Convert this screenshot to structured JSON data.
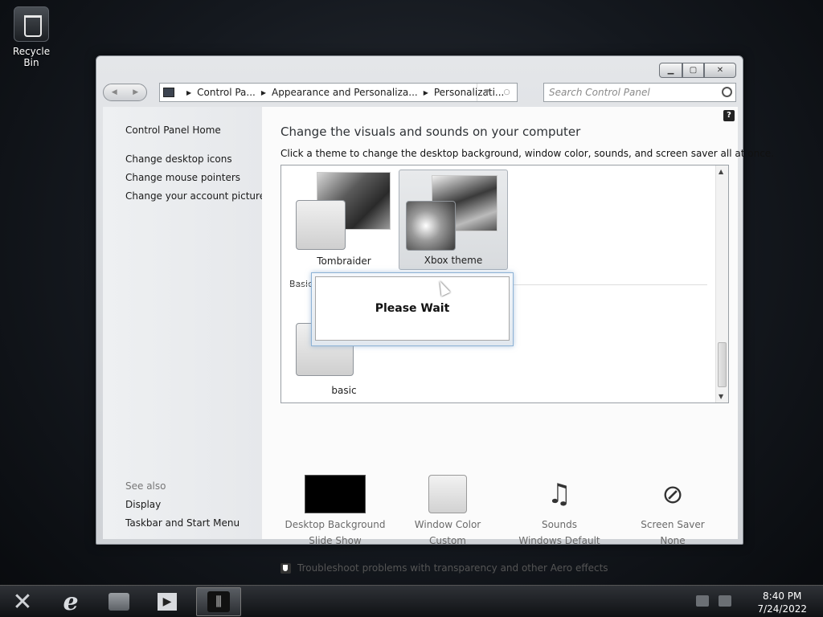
{
  "desktop": {
    "recycle_bin_label": "Recycle Bin"
  },
  "window": {
    "address": {
      "crumbs": [
        "Control Pa...",
        "Appearance and Personaliza...",
        "Personalizati..."
      ]
    },
    "search_placeholder": "Search Control Panel",
    "left_pane": {
      "home": "Control Panel Home",
      "links": [
        "Change desktop icons",
        "Change mouse pointers",
        "Change your account picture"
      ],
      "see_also_label": "See also",
      "see_also_links": [
        "Display",
        "Taskbar and Start Menu"
      ]
    },
    "main": {
      "help_label": "?",
      "heading": "Change the visuals and sounds on your computer",
      "subheading": "Click a theme to change the desktop background, window color, sounds, and screen saver all at once.",
      "themes": [
        "Tombraider",
        "Xbox theme"
      ],
      "basic_section_label": "Basic",
      "basic_themes": [
        "basic"
      ],
      "bottom_items": [
        {
          "title": "Desktop Background",
          "value": "Slide Show",
          "icon": "black-swatch-icon"
        },
        {
          "title": "Window Color",
          "value": "Custom",
          "icon": "color-tile-icon"
        },
        {
          "title": "Sounds",
          "value": "Windows Default",
          "icon": "music-keyboard-icon"
        },
        {
          "title": "Screen Saver",
          "value": "None",
          "icon": "no-screensaver-icon"
        }
      ],
      "troubleshoot": "Troubleshoot problems with transparency and other Aero effects"
    }
  },
  "dialog": {
    "message": "Please Wait"
  },
  "taskbar": {
    "time": "8:40 PM",
    "date": "7/24/2022"
  },
  "colors": {
    "taskbar": "#1c1e22",
    "window_chrome": "#d9dcdf",
    "selection": "#d8dbde"
  }
}
